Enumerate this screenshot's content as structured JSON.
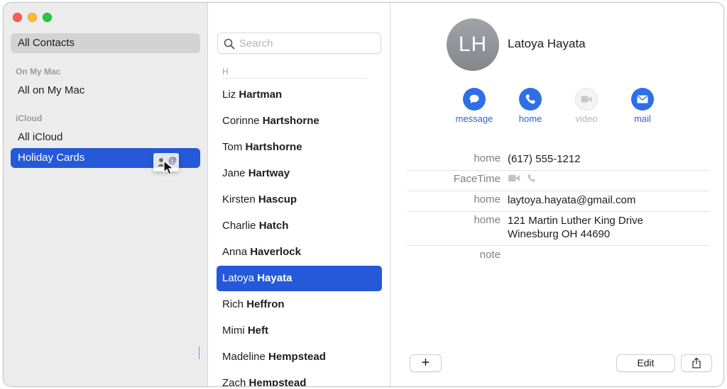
{
  "sidebar": {
    "all_contacts": "All Contacts",
    "on_my_mac_header": "On My Mac",
    "all_on_my_mac": "All on My Mac",
    "icloud_header": "iCloud",
    "all_icloud": "All iCloud",
    "holiday_cards": "Holiday Cards",
    "drag_badge_at": "@"
  },
  "list": {
    "search_placeholder": "Search",
    "section_letter": "H",
    "contacts": [
      {
        "first": "Liz",
        "last": "Hartman"
      },
      {
        "first": "Corinne",
        "last": "Hartshorne"
      },
      {
        "first": "Tom",
        "last": "Hartshorne"
      },
      {
        "first": "Jane",
        "last": "Hartway"
      },
      {
        "first": "Kirsten",
        "last": "Hascup"
      },
      {
        "first": "Charlie",
        "last": "Hatch"
      },
      {
        "first": "Anna",
        "last": "Haverlock"
      },
      {
        "first": "Latoya",
        "last": "Hayata"
      },
      {
        "first": "Rich",
        "last": "Heffron"
      },
      {
        "first": "Mimi",
        "last": "Heft"
      },
      {
        "first": "Madeline",
        "last": "Hempstead"
      },
      {
        "first": "Zach",
        "last": "Hempstead"
      }
    ]
  },
  "detail": {
    "initials": "LH",
    "name": "Latoya Hayata",
    "actions": {
      "message": "message",
      "home": "home",
      "video": "video",
      "mail": "mail"
    },
    "fields": {
      "phone_label": "home",
      "phone_value": "(617) 555-1212",
      "facetime_label": "FaceTime",
      "email_label": "home",
      "email_value": "laytoya.hayata@gmail.com",
      "address_label": "home",
      "address_line1": "121 Martin Luther King Drive",
      "address_line2": "Winesburg OH 44690",
      "note_label": "note"
    },
    "buttons": {
      "add": "+",
      "edit": "Edit"
    }
  },
  "colors": {
    "accent": "#2659d9",
    "action_blue": "#2e6fe6"
  },
  "icons": [
    "search-icon",
    "message-icon",
    "phone-icon",
    "video-icon",
    "mail-icon",
    "share-icon",
    "person-card-icon",
    "cursor-icon"
  ]
}
